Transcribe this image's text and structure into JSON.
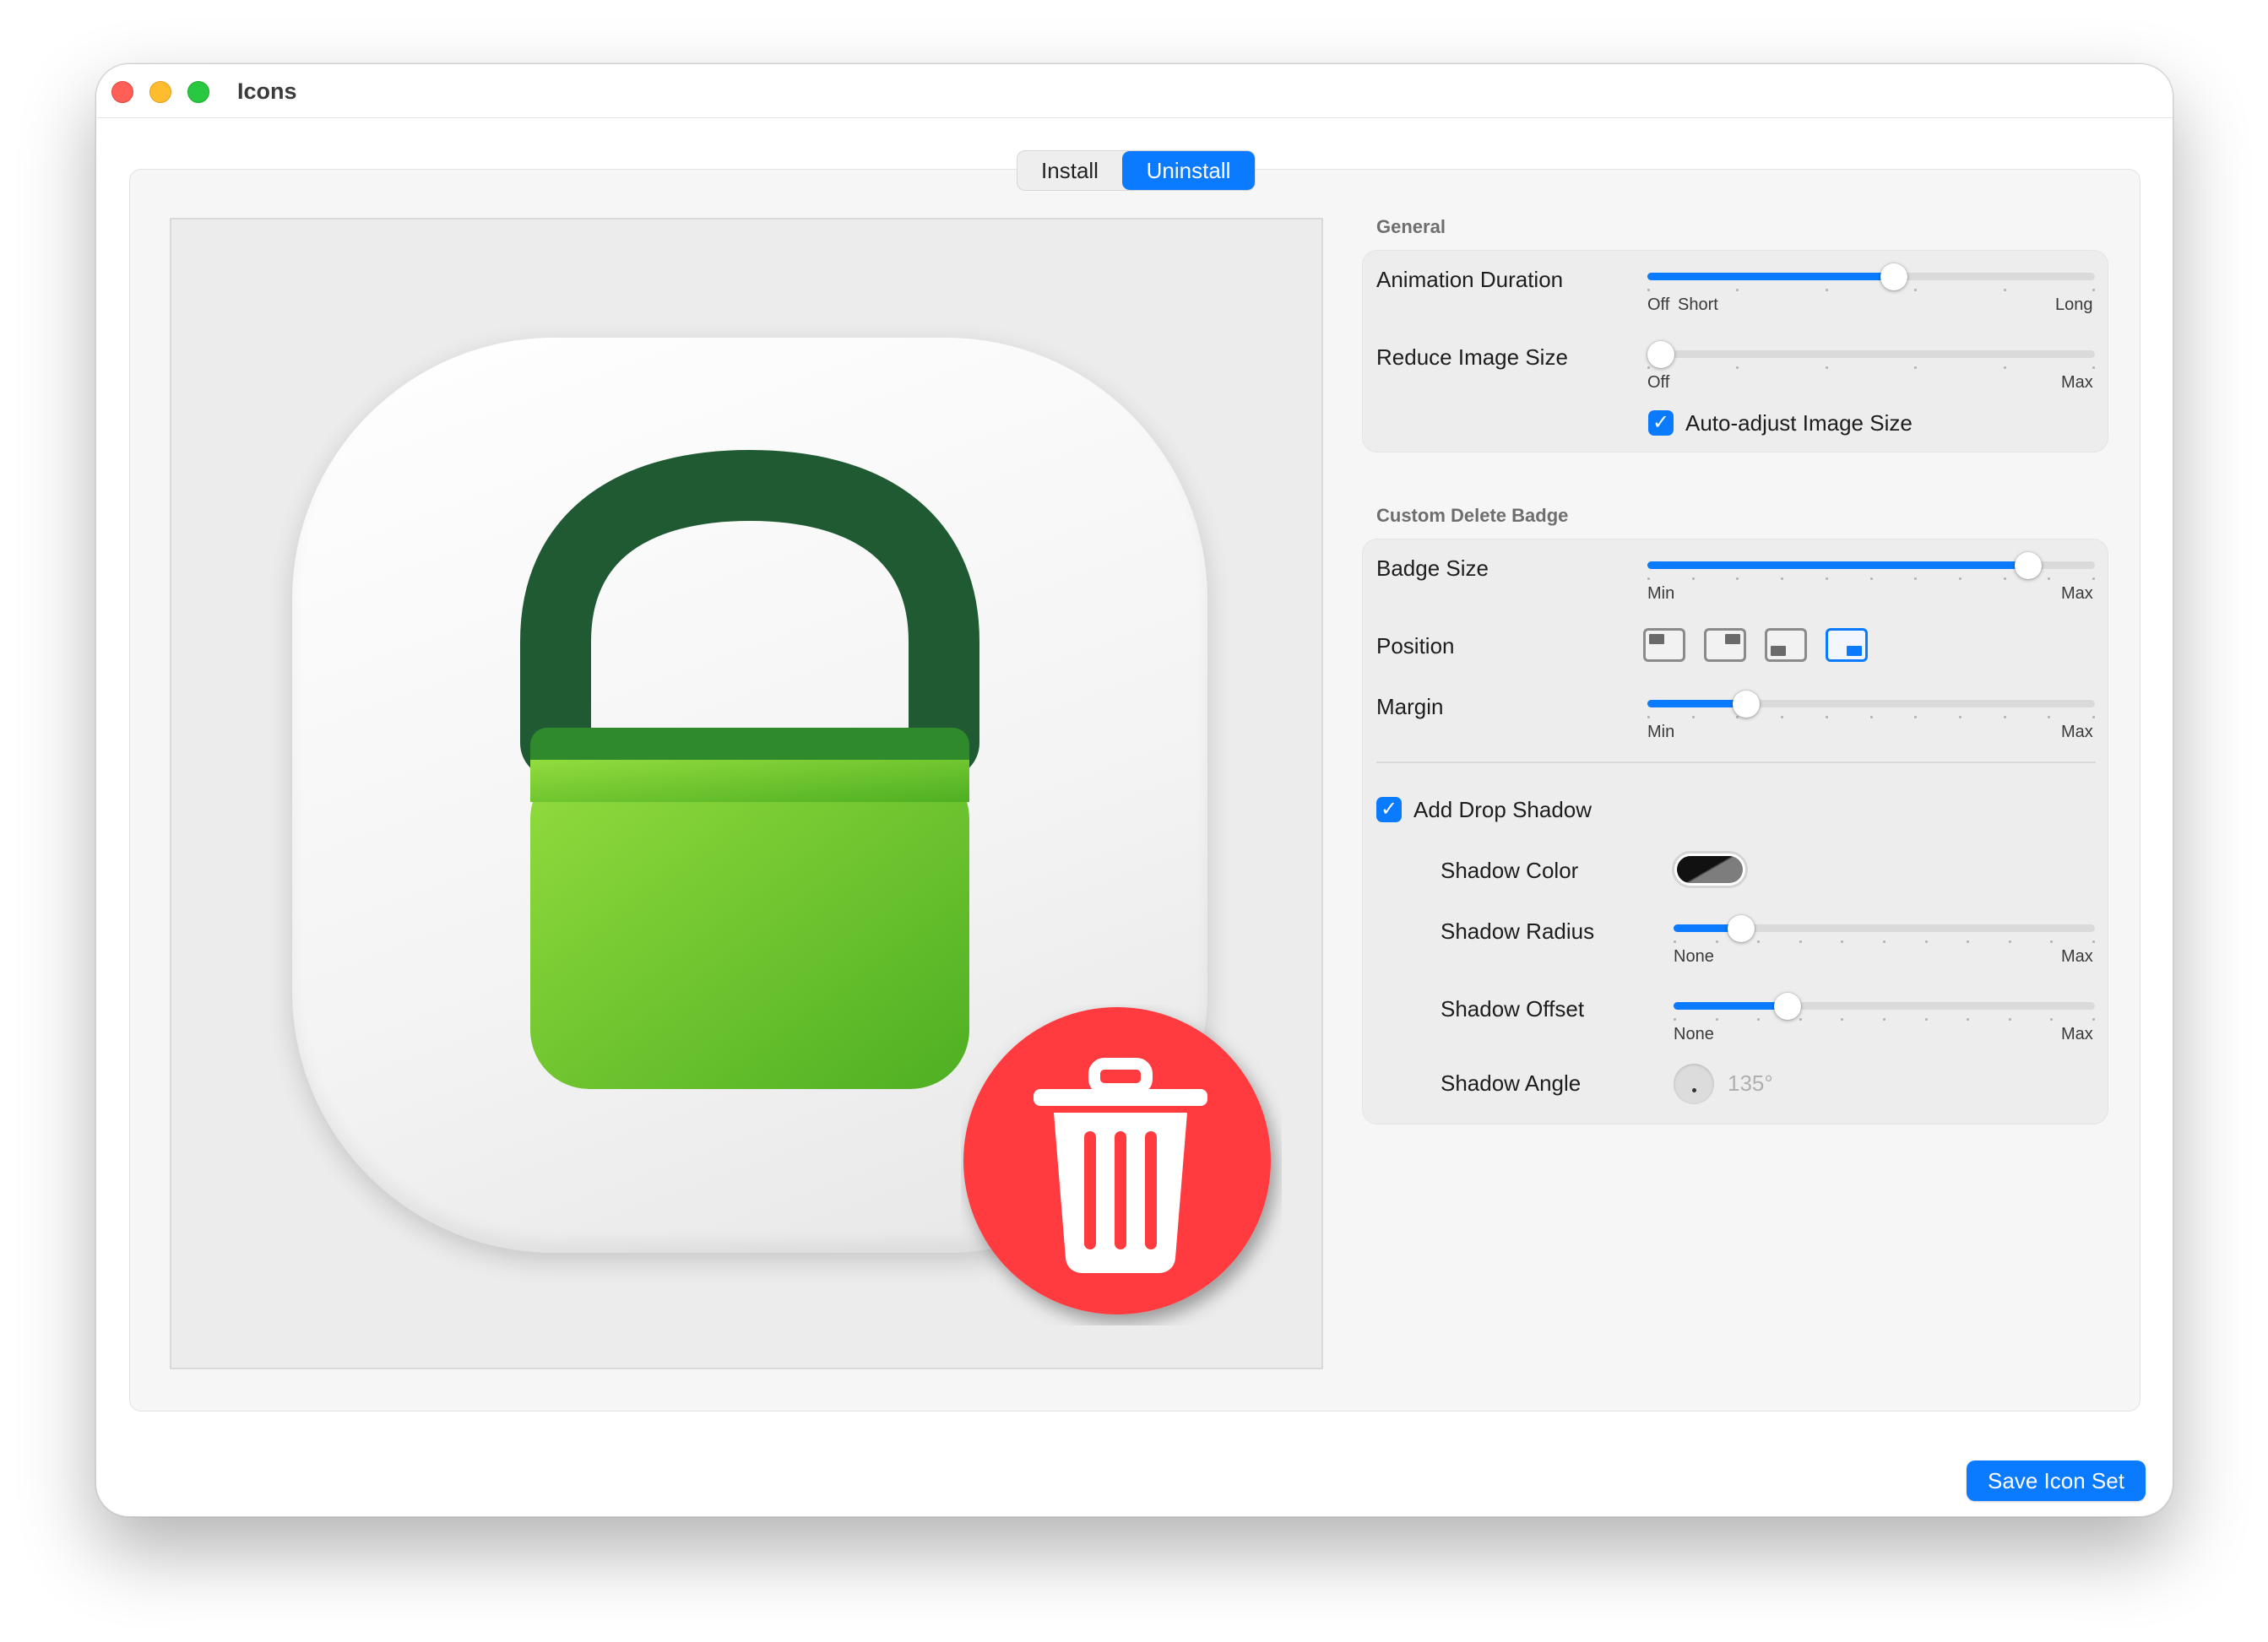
{
  "window": {
    "title": "Icons"
  },
  "tabs": [
    {
      "label": "Install",
      "selected": false
    },
    {
      "label": "Uninstall",
      "selected": true
    }
  ],
  "general": {
    "title": "General",
    "animation_duration": {
      "label": "Animation Duration",
      "value": 0.55,
      "min_label": "Off",
      "mid_label": "Short",
      "max_label": "Long"
    },
    "reduce_image_size": {
      "label": "Reduce Image Size",
      "value": 0.0,
      "min_label": "Off",
      "max_label": "Max"
    },
    "auto_adjust": {
      "label": "Auto-adjust Image Size",
      "checked": true
    }
  },
  "badge": {
    "title": "Custom Delete Badge",
    "badge_size": {
      "label": "Badge Size",
      "value": 0.85,
      "min_label": "Min",
      "max_label": "Max"
    },
    "position": {
      "label": "Position",
      "options": [
        "top-left",
        "top-right",
        "bottom-left",
        "bottom-right"
      ],
      "selected": "bottom-right"
    },
    "margin": {
      "label": "Margin",
      "value": 0.22,
      "min_label": "Min",
      "max_label": "Max"
    },
    "drop_shadow": {
      "label": "Add Drop Shadow",
      "checked": true
    },
    "shadow_color": {
      "label": "Shadow Color"
    },
    "shadow_radius": {
      "label": "Shadow Radius",
      "value": 0.16,
      "min_label": "None",
      "max_label": "Max"
    },
    "shadow_offset": {
      "label": "Shadow Offset",
      "value": 0.27,
      "min_label": "None",
      "max_label": "Max"
    },
    "shadow_angle": {
      "label": "Shadow Angle",
      "value": "135°"
    }
  },
  "actions": {
    "save_label": "Save Icon Set"
  },
  "colors": {
    "accent": "#0a7aff",
    "badge_red": "#ff3b3f",
    "lock_green": "#5fc02f",
    "shackle_green": "#1f5a33"
  }
}
